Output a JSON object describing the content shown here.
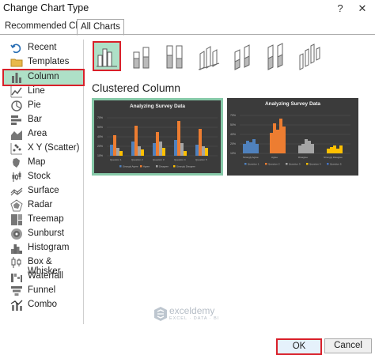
{
  "window": {
    "title": "Change Chart Type",
    "help_glyph": "?",
    "close_glyph": "✕"
  },
  "tabs": [
    {
      "label": "Recommended Charts"
    },
    {
      "label": "All Charts"
    }
  ],
  "sidebar": {
    "items": [
      {
        "label": "Recent",
        "icon": "recent-icon"
      },
      {
        "label": "Templates",
        "icon": "templates-folder-icon"
      },
      {
        "label": "Column",
        "icon": "column-chart-icon",
        "selected": true
      },
      {
        "label": "Line",
        "icon": "line-chart-icon"
      },
      {
        "label": "Pie",
        "icon": "pie-chart-icon"
      },
      {
        "label": "Bar",
        "icon": "bar-chart-icon"
      },
      {
        "label": "Area",
        "icon": "area-chart-icon"
      },
      {
        "label": "X Y (Scatter)",
        "icon": "scatter-chart-icon"
      },
      {
        "label": "Map",
        "icon": "map-chart-icon"
      },
      {
        "label": "Stock",
        "icon": "stock-chart-icon"
      },
      {
        "label": "Surface",
        "icon": "surface-chart-icon"
      },
      {
        "label": "Radar",
        "icon": "radar-chart-icon"
      },
      {
        "label": "Treemap",
        "icon": "treemap-chart-icon"
      },
      {
        "label": "Sunburst",
        "icon": "sunburst-chart-icon"
      },
      {
        "label": "Histogram",
        "icon": "histogram-chart-icon"
      },
      {
        "label": "Box & Whisker",
        "icon": "box-whisker-chart-icon"
      },
      {
        "label": "Waterfall",
        "icon": "waterfall-chart-icon"
      },
      {
        "label": "Funnel",
        "icon": "funnel-chart-icon"
      },
      {
        "label": "Combo",
        "icon": "combo-chart-icon"
      }
    ]
  },
  "subtype_heading": "Clustered Column",
  "previews": [
    {
      "title": "Analyzing Survey Data"
    },
    {
      "title": "Analyzing Survey Data"
    }
  ],
  "watermark": {
    "name": "exceldemy",
    "tagline": "EXCEL · DATA · BI"
  },
  "buttons": {
    "ok": "OK",
    "cancel": "Cancel"
  },
  "colors": {
    "selected_bg": "#aee0c7",
    "highlight_red": "#d9202a",
    "preview_bg": "#3b3b3b",
    "preview_border": "#86c9a8"
  }
}
